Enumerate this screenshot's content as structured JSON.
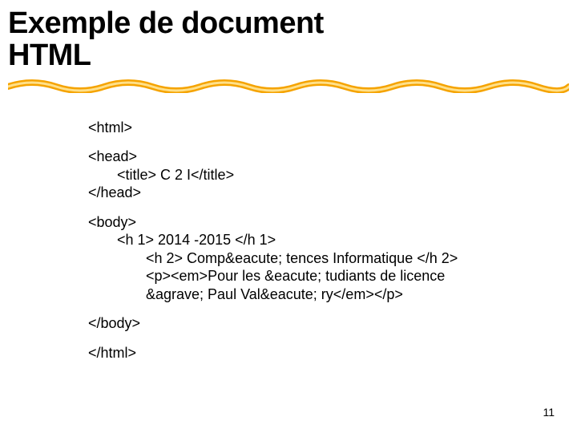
{
  "title_line1": "Exemple de document",
  "title_line2": "HTML",
  "code": {
    "html_open": "<html>",
    "head_open": "<head>",
    "title_line": "<title> C 2 I</title>",
    "head_close": "</head>",
    "body_open": "<body>",
    "h1_line": "<h 1> 2014 -2015 </h 1>",
    "h2_line": "<h 2> Comp&eacute; tences Informatique </h 2>",
    "p_line1": "<p><em>Pour les &eacute; tudiants de licence",
    "p_line2": "&agrave; Paul Val&eacute; ry</em></p>",
    "body_close": "</body>",
    "html_close": "</html>"
  },
  "page_number": "11"
}
